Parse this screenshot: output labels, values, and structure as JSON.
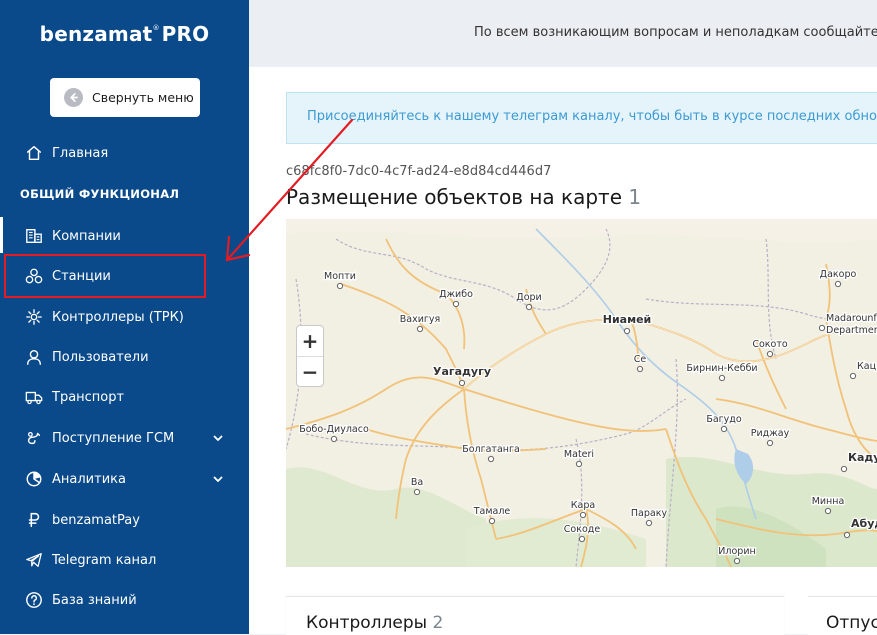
{
  "app": {
    "logo": "benzamat",
    "logo_mark": "®",
    "logo_suffix": "PRO"
  },
  "sidebar": {
    "collapse_label": "Свернуть меню",
    "section_heading": "ОБЩИЙ ФУНКЦИОНАЛ",
    "items": [
      {
        "label": "Главная",
        "icon": "home-icon"
      },
      {
        "label": "Компании",
        "icon": "building-icon"
      },
      {
        "label": "Станции",
        "icon": "stations-icon"
      },
      {
        "label": "Контроллеры (ТРК)",
        "icon": "controller-icon"
      },
      {
        "label": "Пользователи",
        "icon": "user-icon"
      },
      {
        "label": "Транспорт",
        "icon": "truck-icon"
      },
      {
        "label": "Поступление ГСМ",
        "icon": "fuel-icon"
      },
      {
        "label": "Аналитика",
        "icon": "chart-icon"
      },
      {
        "label": "benzamatPay",
        "icon": "ruble-icon"
      },
      {
        "label": "Telegram канал",
        "icon": "telegram-icon"
      },
      {
        "label": "База знаний",
        "icon": "help-icon"
      }
    ]
  },
  "topbar": {
    "notice": "По всем возникающим вопросам и неполадкам сообщайте"
  },
  "banner": {
    "text": "Присоединяйтесь к нашему телеграм каналу, чтобы быть в курсе последних обнов"
  },
  "station": {
    "uuid": "c68fc8f0-7dc0-4c7f-ad24-e8d84cd446d7",
    "title": "Размещение объектов на карте",
    "title_count": "1"
  },
  "map": {
    "zoom_in": "+",
    "zoom_out": "−",
    "places": [
      {
        "name": "Мопти",
        "big": false
      },
      {
        "name": "Джибо",
        "big": false
      },
      {
        "name": "Дори",
        "big": false
      },
      {
        "name": "Вахигуя",
        "big": false
      },
      {
        "name": "Ниамей",
        "big": true
      },
      {
        "name": "Дакоро",
        "big": false
      },
      {
        "name": "Madarounfa",
        "big": false
      },
      {
        "name": "Departmen",
        "big": false
      },
      {
        "name": "Уагадугу",
        "big": true
      },
      {
        "name": "Се",
        "big": false
      },
      {
        "name": "Сокото",
        "big": false
      },
      {
        "name": "Бирнин-Кебби",
        "big": false
      },
      {
        "name": "Кац",
        "big": false
      },
      {
        "name": "Бобо-Диуласо",
        "big": false
      },
      {
        "name": "Багудо",
        "big": false
      },
      {
        "name": "Риджау",
        "big": false
      },
      {
        "name": "Болгатанга",
        "big": false
      },
      {
        "name": "Materi",
        "big": false
      },
      {
        "name": "Каду",
        "big": true
      },
      {
        "name": "Ва",
        "big": false
      },
      {
        "name": "Минна",
        "big": false
      },
      {
        "name": "Тамале",
        "big": false
      },
      {
        "name": "Кара",
        "big": false
      },
      {
        "name": "Параку",
        "big": false
      },
      {
        "name": "Абуд",
        "big": true
      },
      {
        "name": "Сокоде",
        "big": false
      },
      {
        "name": "Илорин",
        "big": false
      }
    ]
  },
  "panels": {
    "controllers_title": "Контроллеры",
    "controllers_count": "2",
    "second_title": "Отпус"
  }
}
